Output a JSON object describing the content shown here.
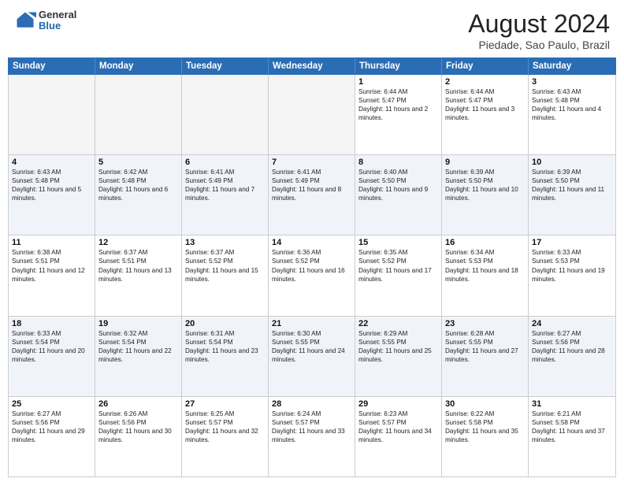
{
  "header": {
    "logo": {
      "general": "General",
      "blue": "Blue"
    },
    "title": "August 2024",
    "subtitle": "Piedade, Sao Paulo, Brazil"
  },
  "calendar": {
    "days_of_week": [
      "Sunday",
      "Monday",
      "Tuesday",
      "Wednesday",
      "Thursday",
      "Friday",
      "Saturday"
    ],
    "weeks": [
      [
        {
          "day": "",
          "empty": true
        },
        {
          "day": "",
          "empty": true
        },
        {
          "day": "",
          "empty": true
        },
        {
          "day": "",
          "empty": true
        },
        {
          "day": "1",
          "sunrise": "6:44 AM",
          "sunset": "5:47 PM",
          "daylight": "11 hours and 2 minutes."
        },
        {
          "day": "2",
          "sunrise": "6:44 AM",
          "sunset": "5:47 PM",
          "daylight": "11 hours and 3 minutes."
        },
        {
          "day": "3",
          "sunrise": "6:43 AM",
          "sunset": "5:48 PM",
          "daylight": "11 hours and 4 minutes."
        }
      ],
      [
        {
          "day": "4",
          "sunrise": "6:43 AM",
          "sunset": "5:48 PM",
          "daylight": "11 hours and 5 minutes."
        },
        {
          "day": "5",
          "sunrise": "6:42 AM",
          "sunset": "5:48 PM",
          "daylight": "11 hours and 6 minutes."
        },
        {
          "day": "6",
          "sunrise": "6:41 AM",
          "sunset": "5:49 PM",
          "daylight": "11 hours and 7 minutes."
        },
        {
          "day": "7",
          "sunrise": "6:41 AM",
          "sunset": "5:49 PM",
          "daylight": "11 hours and 8 minutes."
        },
        {
          "day": "8",
          "sunrise": "6:40 AM",
          "sunset": "5:50 PM",
          "daylight": "11 hours and 9 minutes."
        },
        {
          "day": "9",
          "sunrise": "6:39 AM",
          "sunset": "5:50 PM",
          "daylight": "11 hours and 10 minutes."
        },
        {
          "day": "10",
          "sunrise": "6:39 AM",
          "sunset": "5:50 PM",
          "daylight": "11 hours and 11 minutes."
        }
      ],
      [
        {
          "day": "11",
          "sunrise": "6:38 AM",
          "sunset": "5:51 PM",
          "daylight": "11 hours and 12 minutes."
        },
        {
          "day": "12",
          "sunrise": "6:37 AM",
          "sunset": "5:51 PM",
          "daylight": "11 hours and 13 minutes."
        },
        {
          "day": "13",
          "sunrise": "6:37 AM",
          "sunset": "5:52 PM",
          "daylight": "11 hours and 15 minutes."
        },
        {
          "day": "14",
          "sunrise": "6:36 AM",
          "sunset": "5:52 PM",
          "daylight": "11 hours and 16 minutes."
        },
        {
          "day": "15",
          "sunrise": "6:35 AM",
          "sunset": "5:52 PM",
          "daylight": "11 hours and 17 minutes."
        },
        {
          "day": "16",
          "sunrise": "6:34 AM",
          "sunset": "5:53 PM",
          "daylight": "11 hours and 18 minutes."
        },
        {
          "day": "17",
          "sunrise": "6:33 AM",
          "sunset": "5:53 PM",
          "daylight": "11 hours and 19 minutes."
        }
      ],
      [
        {
          "day": "18",
          "sunrise": "6:33 AM",
          "sunset": "5:54 PM",
          "daylight": "11 hours and 20 minutes."
        },
        {
          "day": "19",
          "sunrise": "6:32 AM",
          "sunset": "5:54 PM",
          "daylight": "11 hours and 22 minutes."
        },
        {
          "day": "20",
          "sunrise": "6:31 AM",
          "sunset": "5:54 PM",
          "daylight": "11 hours and 23 minutes."
        },
        {
          "day": "21",
          "sunrise": "6:30 AM",
          "sunset": "5:55 PM",
          "daylight": "11 hours and 24 minutes."
        },
        {
          "day": "22",
          "sunrise": "6:29 AM",
          "sunset": "5:55 PM",
          "daylight": "11 hours and 25 minutes."
        },
        {
          "day": "23",
          "sunrise": "6:28 AM",
          "sunset": "5:55 PM",
          "daylight": "11 hours and 27 minutes."
        },
        {
          "day": "24",
          "sunrise": "6:27 AM",
          "sunset": "5:56 PM",
          "daylight": "11 hours and 28 minutes."
        }
      ],
      [
        {
          "day": "25",
          "sunrise": "6:27 AM",
          "sunset": "5:56 PM",
          "daylight": "11 hours and 29 minutes."
        },
        {
          "day": "26",
          "sunrise": "6:26 AM",
          "sunset": "5:56 PM",
          "daylight": "11 hours and 30 minutes."
        },
        {
          "day": "27",
          "sunrise": "6:25 AM",
          "sunset": "5:57 PM",
          "daylight": "11 hours and 32 minutes."
        },
        {
          "day": "28",
          "sunrise": "6:24 AM",
          "sunset": "5:57 PM",
          "daylight": "11 hours and 33 minutes."
        },
        {
          "day": "29",
          "sunrise": "6:23 AM",
          "sunset": "5:57 PM",
          "daylight": "11 hours and 34 minutes."
        },
        {
          "day": "30",
          "sunrise": "6:22 AM",
          "sunset": "5:58 PM",
          "daylight": "11 hours and 35 minutes."
        },
        {
          "day": "31",
          "sunrise": "6:21 AM",
          "sunset": "5:58 PM",
          "daylight": "11 hours and 37 minutes."
        }
      ]
    ],
    "labels": {
      "sunrise": "Sunrise:",
      "sunset": "Sunset:",
      "daylight": "Daylight:"
    }
  }
}
